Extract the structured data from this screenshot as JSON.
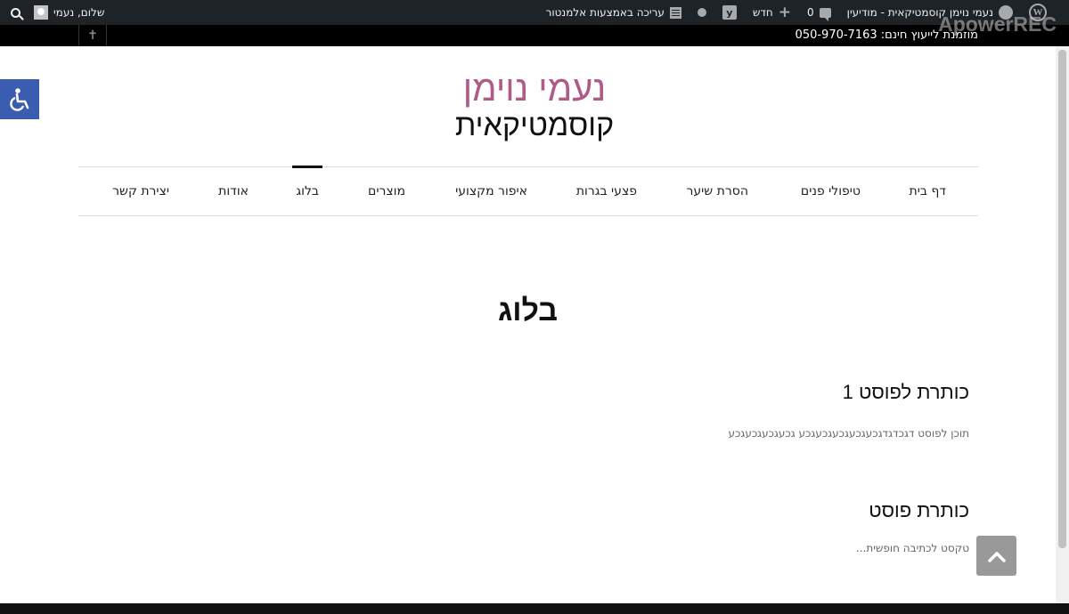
{
  "admin_bar": {
    "site_name": "נעמי נוימן קוסמטיקאית - מודיעין",
    "comments_count": "0",
    "new_label": "חדש",
    "edit_elementor_label": "עריכה באמצעות אלמנטור",
    "greeting": "שלום, נעמי"
  },
  "top_bar": {
    "text": "מוזמנת לייעוץ חינם: 050-970-7163"
  },
  "watermark": "ApowerREC",
  "logo": {
    "line1": "נעמי נוימן",
    "line2": "קוסמטיקאית"
  },
  "nav": {
    "items": [
      {
        "label": "דף בית"
      },
      {
        "label": "טיפולי פנים"
      },
      {
        "label": "הסרת שיער"
      },
      {
        "label": "פצעי בגרות"
      },
      {
        "label": "איפור מקצועי"
      },
      {
        "label": "מוצרים"
      },
      {
        "label": "בלוג"
      },
      {
        "label": "אודות"
      },
      {
        "label": "יצירת קשר"
      }
    ],
    "active": "בלוג"
  },
  "page": {
    "title": "בלוג",
    "posts": [
      {
        "title": "כותרת לפוסט 1",
        "excerpt": "תוכן לפוסט דגכדגדגכעגכעגכעגכעגכע גכעגכעגכעגכע"
      },
      {
        "title": "כותרת פוסט",
        "excerpt": "טקסט לכתיבה חופשית..."
      }
    ]
  },
  "colors": {
    "admin_bar_bg": "#1d2327",
    "logo_accent": "#b05a88",
    "accessibility_bg": "#3b5db1",
    "back_to_top_bg": "#999999"
  }
}
